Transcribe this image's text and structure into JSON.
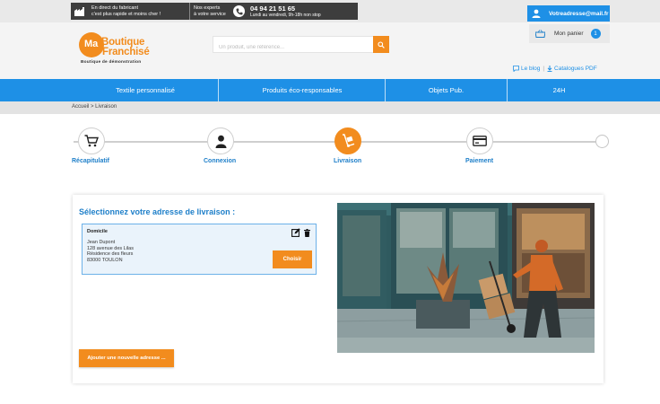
{
  "topbar": {
    "direct_line1": "En direct du fabricant",
    "direct_line2": "c'est plus rapide et moins cher !",
    "experts_line1": "Nos experts",
    "experts_line2": "à votre service",
    "phone": "04 94 21 51 65",
    "hours": "Lundi au vendredi, 9h-18h non stop",
    "account_email": "Votreadresse@mail.fr"
  },
  "logo": {
    "ma": "Ma",
    "word1": "Boutique",
    "word2": "Franchisé",
    "tagline": "Boutique de démonstration"
  },
  "search": {
    "placeholder": "Un produit, une référence..."
  },
  "cart": {
    "label": "Mon panier",
    "count": "1"
  },
  "header_links": {
    "blog": "Le blog",
    "catalogues": "Catalogues PDF"
  },
  "nav": {
    "items": [
      {
        "label": "Textile personnalisé"
      },
      {
        "label": "Produits éco-responsables"
      },
      {
        "label": "Objets Pub."
      },
      {
        "label": "24H"
      }
    ]
  },
  "breadcrumb": "Accueil > Livraison",
  "steps": [
    {
      "label": "Récapitulatif",
      "icon": "cart-icon",
      "active": false
    },
    {
      "label": "Connexion",
      "icon": "user-icon",
      "active": false
    },
    {
      "label": "Livraison",
      "icon": "delivery-icon",
      "active": true
    },
    {
      "label": "Paiement",
      "icon": "card-icon",
      "active": false
    }
  ],
  "delivery": {
    "title": "Sélectionnez votre adresse de livraison :",
    "address": {
      "name": "Domicile",
      "line1": "Jean Dupont",
      "line2": "128 avenue des Lilas",
      "line3": "Résidence des fleurs",
      "line4": "83000 TOULON"
    },
    "choose_label": "Choisir",
    "add_label": "Ajouter une nouvelle adresse ..."
  },
  "colors": {
    "accent": "#f28c1e",
    "brand_blue": "#1e90e6",
    "topbar_dark": "#3d3d3d"
  }
}
